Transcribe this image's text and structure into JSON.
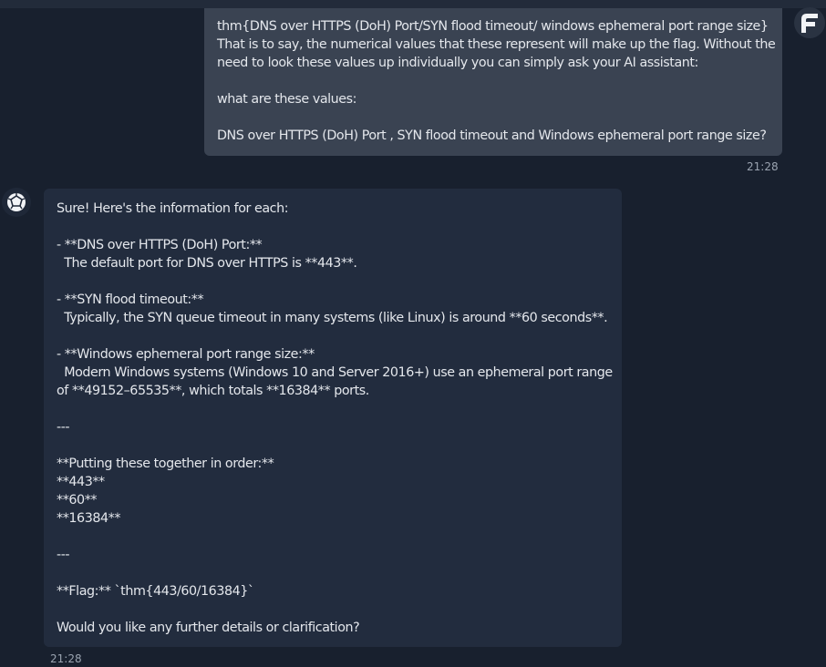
{
  "user_message": {
    "lines": [
      "thm{DNS over HTTPS (DoH) Port/SYN flood timeout/ windows ephemeral port range size}",
      "That is to say, the numerical values that these represent will make up the flag. Without the",
      "need to look these values up individually you can simply ask your AI assistant:",
      "",
      "what are these values:",
      "",
      "DNS over HTTPS (DoH) Port , SYN flood timeout and Windows ephemeral port range size?"
    ],
    "time": "21:28"
  },
  "assistant_message": {
    "lines": [
      "Sure! Here's the information for each:",
      "",
      "- **DNS over HTTPS (DoH) Port:**",
      "  The default port for DNS over HTTPS is **443**.",
      "",
      "- **SYN flood timeout:**",
      "  Typically, the SYN queue timeout in many systems (like Linux) is around **60 seconds**.",
      "",
      "- **Windows ephemeral port range size:**",
      "  Modern Windows systems (Windows 10 and Server 2016+) use an ephemeral port range",
      "of **49152–65535**, which totals **16384** ports.",
      "",
      "---",
      "",
      "**Putting these together in order:**",
      "**443**",
      "**60**",
      "**16384**",
      "",
      "---",
      "",
      "**Flag:** `thm{443/60/16384}`",
      "",
      "Would you like any further details or clarification?"
    ],
    "time": "21:28"
  },
  "icons": {
    "user_avatar": "brand-f-logo-icon",
    "assistant_avatar": "robot-dodecahedron-icon"
  },
  "colors": {
    "background": "#18202e",
    "user_bubble": "#3a4352",
    "assistant_bubble": "#222c3e",
    "text": "#e4e7ec",
    "timestamp": "#9aa3b0"
  }
}
